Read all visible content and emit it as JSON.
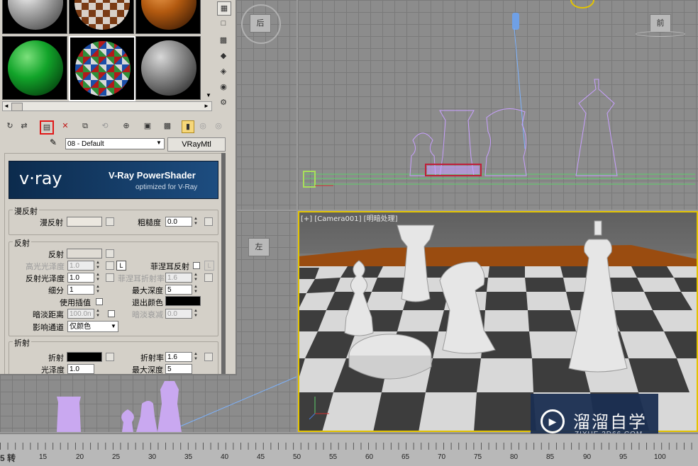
{
  "viewports": {
    "top_left_cube_label": "后",
    "front_cube_label": "前",
    "left_cube_label": "左",
    "camera_label": "[+] [Camera001] [明暗处理]"
  },
  "material_editor": {
    "material_name": "08 - Default",
    "material_type": "VRayMtl",
    "banner": {
      "logo": "v·ray",
      "title": "V-Ray PowerShader",
      "subtitle": "optimized for V-Ray"
    },
    "diffuse": {
      "group": "漫反射",
      "diffuse_label": "漫反射",
      "roughness_label": "粗糙度",
      "roughness_value": "0.0"
    },
    "reflection": {
      "group": "反射",
      "reflect_label": "反射",
      "hilight_gloss_label": "高光光泽度",
      "hilight_gloss_value": "1.0",
      "lock_label": "L",
      "fresnel_label": "菲涅耳反射",
      "refl_gloss_label": "反射光泽度",
      "refl_gloss_value": "1.0",
      "fresnel_ior_label": "菲涅耳折射率",
      "fresnel_ior_value": "1.6",
      "subdivs_label": "细分",
      "subdivs_value": "1",
      "max_depth_label": "最大深度",
      "max_depth_value": "5",
      "use_interp_label": "使用插值",
      "exit_color_label": "退出颜色",
      "dim_distance_label": "暗淡距离",
      "dim_distance_value": "100.0n",
      "dim_falloff_label": "暗淡衰减",
      "dim_falloff_value": "0.0",
      "affect_channels_label": "影响通道",
      "affect_channels_value": "仅颜色"
    },
    "refraction": {
      "group": "折射",
      "refract_label": "折射",
      "ior_label": "折射率",
      "ior_value": "1.6",
      "gloss_label": "光泽度",
      "gloss_value": "1.0",
      "max_depth_label": "最大深度",
      "max_depth_value": "5"
    }
  },
  "watermark": {
    "name": "溜溜自学",
    "url": "ZIXUE.3D66.COM"
  },
  "timeline": {
    "frame_partial": "5 转",
    "ticks": [
      "15",
      "20",
      "25",
      "30",
      "35",
      "40",
      "45",
      "50",
      "55",
      "60",
      "65",
      "70",
      "75",
      "80",
      "85",
      "90",
      "95",
      "100"
    ]
  },
  "colors": {
    "active_viewport": "#e4c400",
    "wireframe": "#c8a0ff",
    "vray_banner": "#16385e",
    "watermark_bg": "#1b2f52"
  }
}
